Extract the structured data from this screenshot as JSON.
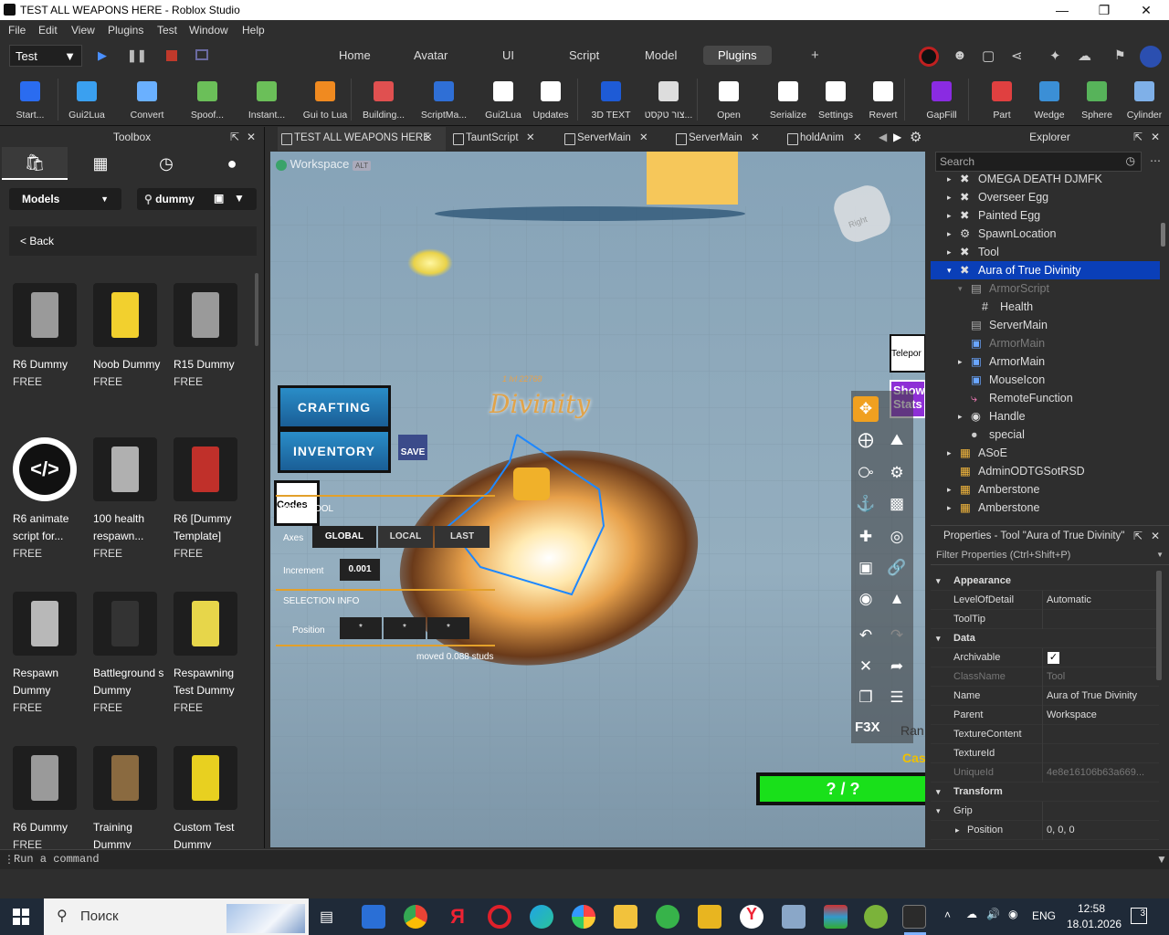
{
  "window": {
    "title": "TEST ALL WEAPONS HERE - Roblox Studio"
  },
  "menu": [
    "File",
    "Edit",
    "View",
    "Plugins",
    "Test",
    "Window",
    "Help"
  ],
  "top": {
    "mode": "Test",
    "tabs": [
      "Home",
      "Avatar",
      "UI",
      "Script",
      "Model",
      "Plugins"
    ],
    "active_tab": "Plugins"
  },
  "ribbon": [
    {
      "label": "Start...",
      "icon": "flame-icon",
      "color": "#2a6cf0"
    },
    {
      "label": "Gui2Lua",
      "icon": "gui2lua-icon",
      "color": "#3aa0f0"
    },
    {
      "label": "Convert",
      "icon": "convert-icon",
      "color": "#6ab0ff"
    },
    {
      "label": "Spoof...",
      "icon": "spoof-icon",
      "color": "#6bbf59"
    },
    {
      "label": "Instant...",
      "icon": "instant-icon",
      "color": "#6bbf59"
    },
    {
      "label": "Gui to Lua",
      "icon": "gui-to-lua-icon",
      "color": "#f08a20"
    },
    {
      "label": "Building...",
      "icon": "building-icon",
      "color": "#e05050"
    },
    {
      "label": "ScriptMa...",
      "icon": "scriptmanager-icon",
      "color": "#2f6fd6"
    },
    {
      "label": "Gui2Lua",
      "icon": "gui2lua-alt-icon",
      "color": "#ffffff"
    },
    {
      "label": "Updates",
      "icon": "updates-icon",
      "color": "#ffffff"
    },
    {
      "label": "3D TEXT",
      "icon": "3d-text-icon",
      "color": "#1e5bd6"
    },
    {
      "label": "צור טקסט...",
      "icon": "hebrew-text-icon",
      "color": "#dddddd"
    },
    {
      "label": "Open",
      "icon": "github-icon",
      "color": "#ffffff"
    },
    {
      "label": "Serialize",
      "icon": "serialize-icon",
      "color": "#ffffff"
    },
    {
      "label": "Settings",
      "icon": "settings-icon",
      "color": "#ffffff"
    },
    {
      "label": "Revert",
      "icon": "revert-icon",
      "color": "#ffffff"
    },
    {
      "label": "GapFill",
      "icon": "gapfill-icon",
      "color": "#8a2be2"
    },
    {
      "label": "Part",
      "icon": "part-icon",
      "color": "#e04040"
    },
    {
      "label": "Wedge",
      "icon": "wedge-icon",
      "color": "#3b8fd6"
    },
    {
      "label": "Sphere",
      "icon": "sphere-icon",
      "color": "#57b35a"
    },
    {
      "label": "Cylinder",
      "icon": "cylinder-icon",
      "color": "#7fb0e8"
    }
  ],
  "toolbox": {
    "title": "Toolbox",
    "category": "Models",
    "search": "dummy",
    "back": "< Back",
    "items": [
      {
        "name": "R6 Dummy",
        "price": "FREE"
      },
      {
        "name": "Noob Dummy",
        "price": "FREE"
      },
      {
        "name": "R15 Dummy",
        "price": "FREE"
      },
      {
        "name": "R6 animate script for...",
        "price": "FREE"
      },
      {
        "name": "100 health respawn...",
        "price": "FREE"
      },
      {
        "name": "R6 [Dummy Template]",
        "price": "FREE"
      },
      {
        "name": "Respawn Dummy",
        "price": "FREE"
      },
      {
        "name": "Battleground s Dummy",
        "price": "FREE"
      },
      {
        "name": "Respawning Test Dummy",
        "price": "FREE"
      },
      {
        "name": "R6 Dummy",
        "price": "FREE"
      },
      {
        "name": "Training Dummy",
        "price": ""
      },
      {
        "name": "Custom Test Dummy",
        "price": ""
      }
    ]
  },
  "doc_tabs": [
    "TEST ALL WEAPONS HERE",
    "TauntScript",
    "ServerMain",
    "ServerMain",
    "holdAnim"
  ],
  "viewport": {
    "workspace": "Workspace",
    "alt": "ALT",
    "nametag_small": "1 lvl 22768",
    "nametag": "Divinity",
    "crafting": "CRAFTING",
    "inventory": "INVENTORY",
    "save": "SAVE",
    "codes": "Codes",
    "teleport": "Telepor",
    "show_stats": "Show Stats",
    "health": "? / ?",
    "ran": "Ran",
    "cas": "Cas",
    "move_tool": {
      "title": "MOVE TOOL",
      "axes": "Axes",
      "global": "GLOBAL",
      "local": "LOCAL",
      "last": "LAST",
      "increment": "Increment",
      "increment_value": "0.001",
      "selection_info": "SELECTION INFO",
      "position": "Position",
      "pos_vals": [
        "*",
        "*",
        "*"
      ],
      "moved": "moved 0.088 studs"
    },
    "f3x": "F3X"
  },
  "explorer": {
    "title": "Explorer",
    "search_placeholder": "Search",
    "rows": [
      {
        "text": "OMEGA DEATH DJMFK",
        "indent": 0,
        "arrow": "▸",
        "icon": "tool-icon",
        "state": ""
      },
      {
        "text": "Overseer Egg",
        "indent": 0,
        "arrow": "▸",
        "icon": "tool-icon",
        "state": ""
      },
      {
        "text": "Painted Egg",
        "indent": 0,
        "arrow": "▸",
        "icon": "tool-icon",
        "state": ""
      },
      {
        "text": "SpawnLocation",
        "indent": 0,
        "arrow": "▸",
        "icon": "spawn-icon",
        "state": ""
      },
      {
        "text": "Tool",
        "indent": 0,
        "arrow": "▸",
        "icon": "tool-icon",
        "state": ""
      },
      {
        "text": "Aura of True Divinity",
        "indent": 0,
        "arrow": "▾",
        "icon": "tool-icon",
        "state": "sel"
      },
      {
        "text": "ArmorScript",
        "indent": 1,
        "arrow": "▾",
        "icon": "script-icon",
        "state": "dim"
      },
      {
        "text": "Health",
        "indent": 2,
        "arrow": "",
        "icon": "number-value-icon",
        "state": ""
      },
      {
        "text": "ServerMain",
        "indent": 1,
        "arrow": "",
        "icon": "script-icon",
        "state": ""
      },
      {
        "text": "ArmorMain",
        "indent": 1,
        "arrow": "",
        "icon": "local-script-icon",
        "state": "dim"
      },
      {
        "text": "ArmorMain",
        "indent": 1,
        "arrow": "▸",
        "icon": "local-script-icon",
        "state": ""
      },
      {
        "text": "MouseIcon",
        "indent": 1,
        "arrow": "",
        "icon": "local-script-icon",
        "state": ""
      },
      {
        "text": "RemoteFunction",
        "indent": 1,
        "arrow": "",
        "icon": "remote-function-icon",
        "state": ""
      },
      {
        "text": "Handle",
        "indent": 1,
        "arrow": "▸",
        "icon": "part-icon",
        "state": ""
      },
      {
        "text": "special",
        "indent": 1,
        "arrow": "",
        "icon": "mesh-icon",
        "state": ""
      },
      {
        "text": "ASoE",
        "indent": 0,
        "arrow": "▸",
        "icon": "model-icon",
        "state": ""
      },
      {
        "text": "AdminODTGSotRSD",
        "indent": 0,
        "arrow": "",
        "icon": "model-icon",
        "state": ""
      },
      {
        "text": "Amberstone",
        "indent": 0,
        "arrow": "▸",
        "icon": "model-icon",
        "state": ""
      },
      {
        "text": "Amberstone",
        "indent": 0,
        "arrow": "▸",
        "icon": "model-icon",
        "state": ""
      }
    ]
  },
  "properties": {
    "title": "Properties - Tool \"Aura of True Divinity\"",
    "filter": "Filter Properties (Ctrl+Shift+P)",
    "rows": [
      {
        "k": "Appearance",
        "v": "",
        "type": "section"
      },
      {
        "k": "LevelOfDetail",
        "v": "Automatic",
        "type": ""
      },
      {
        "k": "ToolTip",
        "v": "",
        "type": ""
      },
      {
        "k": "Data",
        "v": "",
        "type": "section"
      },
      {
        "k": "Archivable",
        "v": "",
        "type": "check"
      },
      {
        "k": "ClassName",
        "v": "Tool",
        "type": "dim"
      },
      {
        "k": "Name",
        "v": "Aura of True Divinity",
        "type": ""
      },
      {
        "k": "Parent",
        "v": "Workspace",
        "type": ""
      },
      {
        "k": "TextureContent",
        "v": "",
        "type": ""
      },
      {
        "k": "TextureId",
        "v": "",
        "type": ""
      },
      {
        "k": "UniqueId",
        "v": "4e8e16106b63a669...",
        "type": "dim"
      },
      {
        "k": "Transform",
        "v": "",
        "type": "section"
      },
      {
        "k": "Grip",
        "v": "",
        "type": "subsection"
      },
      {
        "k": "Position",
        "v": "0, 0, 0",
        "type": "child"
      }
    ]
  },
  "command_bar": {
    "placeholder": "Run a command"
  },
  "taskbar": {
    "search": "Поиск",
    "lang": "ENG",
    "time": "12:58",
    "date": "18.01.2026",
    "notif": "3"
  }
}
